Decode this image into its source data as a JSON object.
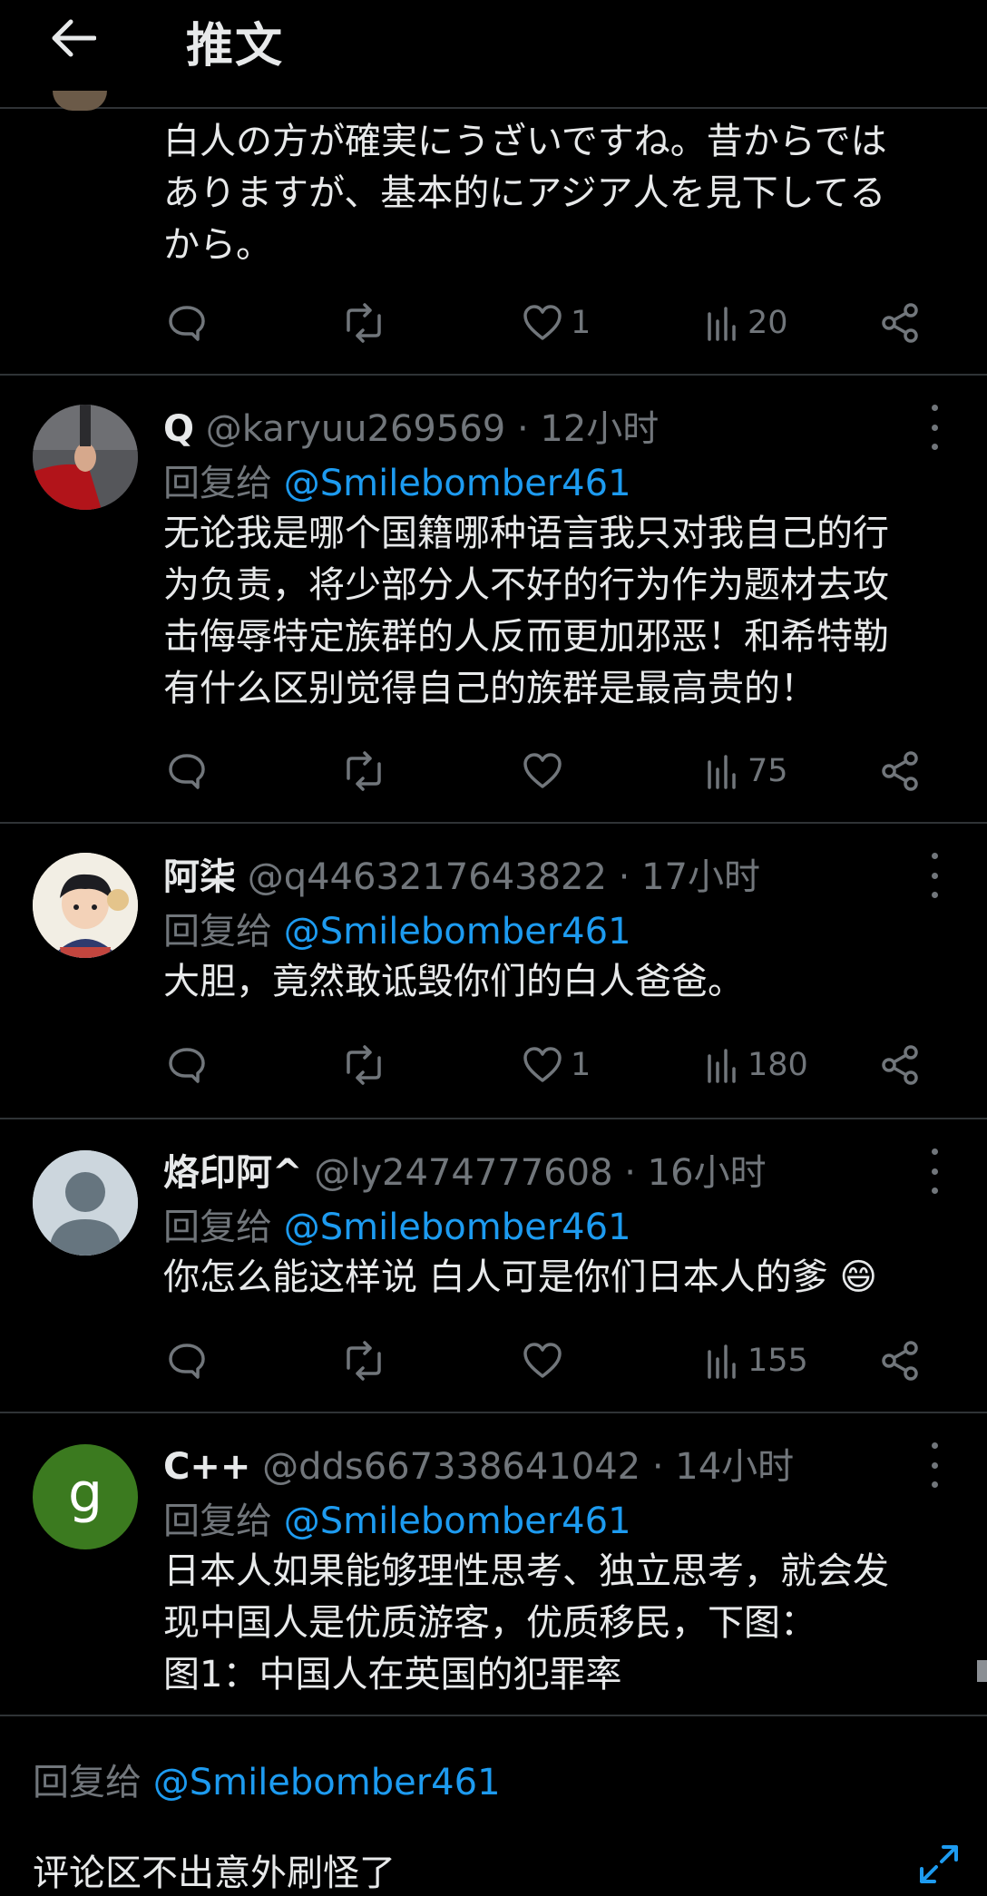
{
  "header": {
    "title": "推文"
  },
  "top_reply": {
    "lines": [
      "白人の方が確実にうざいですね。昔からでは",
      "ありますが、基本的にアジア人を見下してる",
      "から。"
    ],
    "likes": "1",
    "views": "20"
  },
  "tweets": [
    {
      "name": "Q",
      "handle": "@karyuu269569",
      "sep": "·",
      "time": "12小时",
      "reply_prefix": "回复给",
      "reply_to": "@Smilebomber461",
      "lines": [
        "无论我是哪个国籍哪种语言我只对我自己的行",
        "为负责，将少部分人不好的行为作为题材去攻",
        "击侮辱特定族群的人反而更加邪恶！和希特勒",
        "有什么区别觉得自己的族群是最高贵的！"
      ],
      "likes": "",
      "views": "75"
    },
    {
      "name": "阿柒",
      "handle": "@q4463217643822",
      "sep": "·",
      "time": "17小时",
      "reply_prefix": "回复给",
      "reply_to": "@Smilebomber461",
      "lines": [
        "大胆，竟然敢诋毁你们的白人爸爸。"
      ],
      "likes": "1",
      "views": "180"
    },
    {
      "name": "烙印阿^",
      "handle": "@ly2474777608",
      "sep": "·",
      "time": "16小时",
      "reply_prefix": "回复给",
      "reply_to": "@Smilebomber461",
      "lines": [
        "你怎么能这样说 白人可是你们日本人的爹 😄"
      ],
      "likes": "",
      "views": "155"
    },
    {
      "name": "C++",
      "handle": "@dds667338641042",
      "sep": "·",
      "time": "14小时",
      "avatar_letter": "g",
      "reply_prefix": "回复给",
      "reply_to": "@Smilebomber461",
      "lines": [
        "日本人如果能够理性思考、独立思考，就会发",
        "现中国人是优质游客，优质移民，下图：",
        "图1：中国人在英国的犯罪率"
      ]
    }
  ],
  "composer": {
    "reply_prefix": "回复给",
    "reply_to": "@Smilebomber461",
    "text": "评论区不出意外刷怪了"
  },
  "icons": {
    "back": "back-arrow-icon",
    "reply": "comment-icon",
    "retweet": "retweet-icon",
    "like": "heart-icon",
    "views": "views-chart-icon",
    "share": "share-icon",
    "more": "more-dots-icon"
  },
  "colors": {
    "background": "#000000",
    "text": "#e7e9ea",
    "muted": "#71767b",
    "link": "#1d9bf0",
    "divider": "#2f3336"
  }
}
